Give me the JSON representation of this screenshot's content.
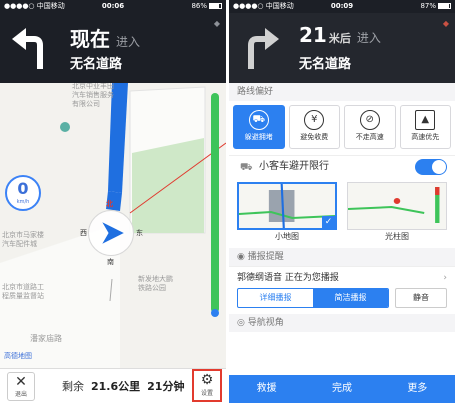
{
  "left": {
    "status": {
      "carrier": "中国移动",
      "time": "00:06",
      "battery": "86%",
      "battery_level": 0.86
    },
    "nav": {
      "distance": "现在",
      "unit": "",
      "enter": "进入",
      "road": "无名道路"
    },
    "map": {
      "speed": "0",
      "speed_unit": "km/h",
      "labels": {
        "dealer_1": "北京中业丰田",
        "dealer_2": "汽车销售服务",
        "dealer_3": "有限公司",
        "market_1": "北京市马家楼",
        "market_2": "汽车配件城",
        "road_1": "北京市道路工",
        "road_2": "程质量监督站",
        "park_1": "新发地大鹏",
        "park_2": "铁路公园",
        "street": "潘家庙路",
        "logo": "高德地图",
        "compass_n": "北",
        "compass_w": "西",
        "compass_e": "东",
        "compass_s": "南"
      }
    },
    "bottom": {
      "exit": "退出",
      "remain_prefix": "剩余",
      "remain_dist": "21.6公里",
      "remain_time": "21分钟",
      "settings": "设置"
    }
  },
  "right": {
    "status": {
      "carrier": "中国移动",
      "time": "00:09",
      "battery": "87%",
      "battery_level": 0.87
    },
    "nav": {
      "distance": "21",
      "unit": "米后",
      "enter": "进入",
      "road": "无名道路"
    },
    "route_title": "路线偏好",
    "prefs": [
      {
        "label": "躲避拥堵",
        "icon": "car-icon",
        "on": true
      },
      {
        "label": "避免收费",
        "icon": "yen-icon",
        "on": false
      },
      {
        "label": "不走高速",
        "icon": "no-highway-icon",
        "on": false
      },
      {
        "label": "高速优先",
        "icon": "highway-icon",
        "on": false
      }
    ],
    "limit_label": "小客车避开限行",
    "maps": [
      {
        "label": "小地图"
      },
      {
        "label": "光柱图"
      }
    ],
    "voice_title": "播报提醒",
    "voice_text": "郭德纲语音 正在为您播报",
    "voice_modes": [
      "详细播报",
      "简洁播报"
    ],
    "mute": "静音",
    "view_title": "导航视角",
    "actions": [
      "救援",
      "完成",
      "更多"
    ]
  },
  "colors": {
    "accent": "#2c80f0",
    "header": "#1c1f26",
    "route": "#1f6fe0",
    "green": "#3ec45a"
  }
}
